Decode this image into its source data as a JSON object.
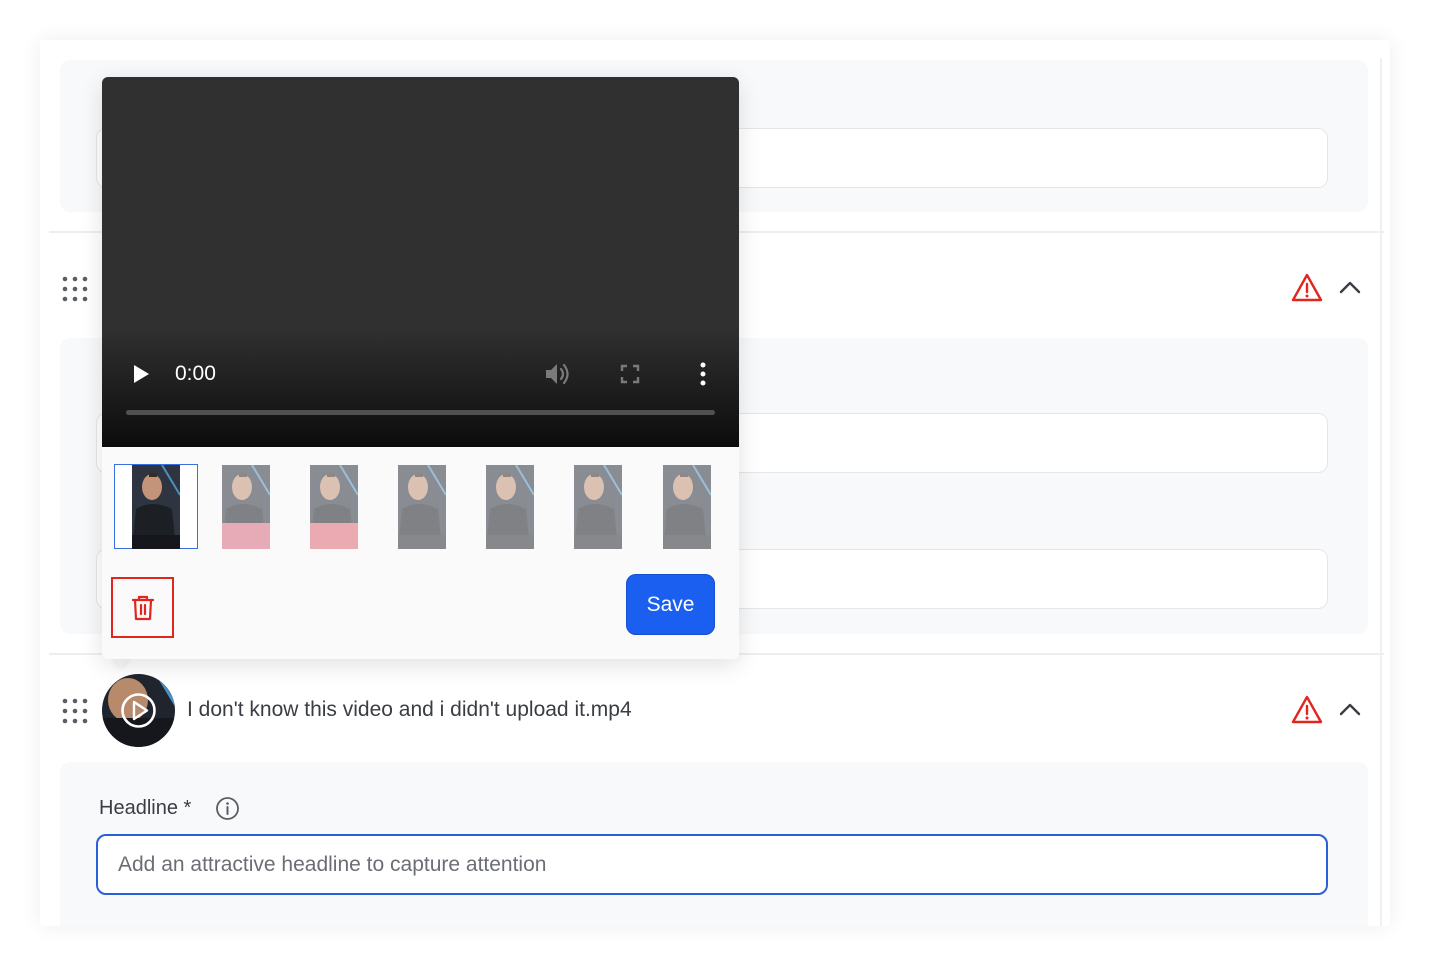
{
  "video_popover": {
    "time": "0:00",
    "progress": 0,
    "thumbnails": [
      {
        "name": "thumbnail-1",
        "selected": true
      },
      {
        "name": "thumbnail-2",
        "selected": false
      },
      {
        "name": "thumbnail-3",
        "selected": false
      },
      {
        "name": "thumbnail-4",
        "selected": false
      },
      {
        "name": "thumbnail-5",
        "selected": false
      },
      {
        "name": "thumbnail-6",
        "selected": false
      },
      {
        "name": "thumbnail-7",
        "selected": false
      }
    ],
    "save_label": "Save",
    "icons": {
      "play": "play-icon",
      "volume": "volume-icon",
      "fullscreen": "fullscreen-icon",
      "more": "more-vertical-icon",
      "delete": "trash-icon"
    }
  },
  "items": [
    {
      "title": "",
      "status": "warning"
    },
    {
      "title": "I don't know this video and i didn't upload it.mp4",
      "status": "warning"
    }
  ],
  "headline": {
    "label": "Headline *",
    "placeholder": "Add an attractive headline to capture attention",
    "value": ""
  },
  "colors": {
    "accent": "#1a5ff0",
    "warning": "#e0261f",
    "field_focus": "#2a5fd8"
  }
}
